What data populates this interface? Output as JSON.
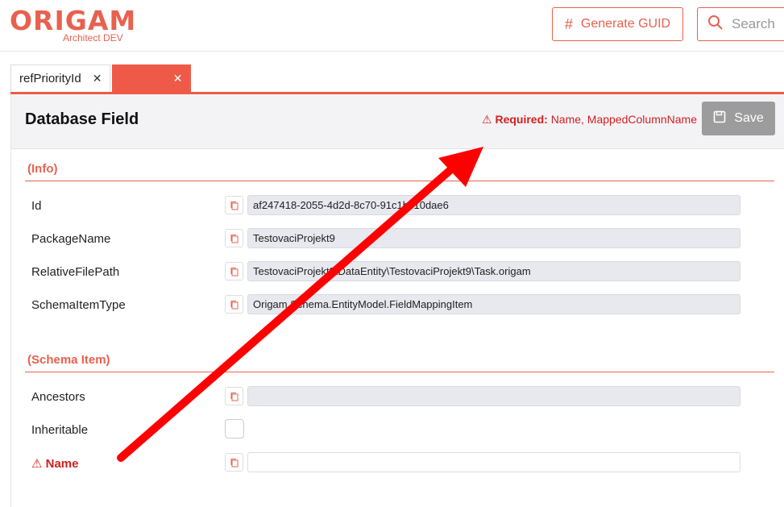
{
  "app": {
    "logo": "ORIGAM",
    "subtitle": "Architect DEV",
    "generate_guid_label": "Generate GUID",
    "search_placeholder": "Search"
  },
  "tabs": [
    {
      "label": "refPriorityId"
    },
    {
      "label": ""
    }
  ],
  "editor": {
    "title": "Database Field",
    "required_label": "Required:",
    "required_fields": "Name, MappedColumnName",
    "save_label": "Save"
  },
  "sections": {
    "info": {
      "title": "(Info)",
      "rows": [
        {
          "label": "Id",
          "value": "af247418-2055-4d2d-8c70-91c1bc10dae6"
        },
        {
          "label": "PackageName",
          "value": "TestovaciProjekt9"
        },
        {
          "label": "RelativeFilePath",
          "value": "TestovaciProjekt9\\DataEntity\\TestovaciProjekt9\\Task.origam"
        },
        {
          "label": "SchemaItemType",
          "value": "Origam.Schema.EntityModel.FieldMappingItem"
        }
      ]
    },
    "schema_item": {
      "title": "(Schema Item)",
      "ancestors_label": "Ancestors",
      "ancestors_value": "",
      "inheritable_label": "Inheritable",
      "name_label": "Name",
      "name_value": ""
    }
  },
  "colors": {
    "accent": "#e8614f",
    "tab_active": "#ef5a48",
    "error": "#d32020",
    "save_disabled": "#9c9c9c",
    "annotation_arrow": "#ff0000"
  }
}
